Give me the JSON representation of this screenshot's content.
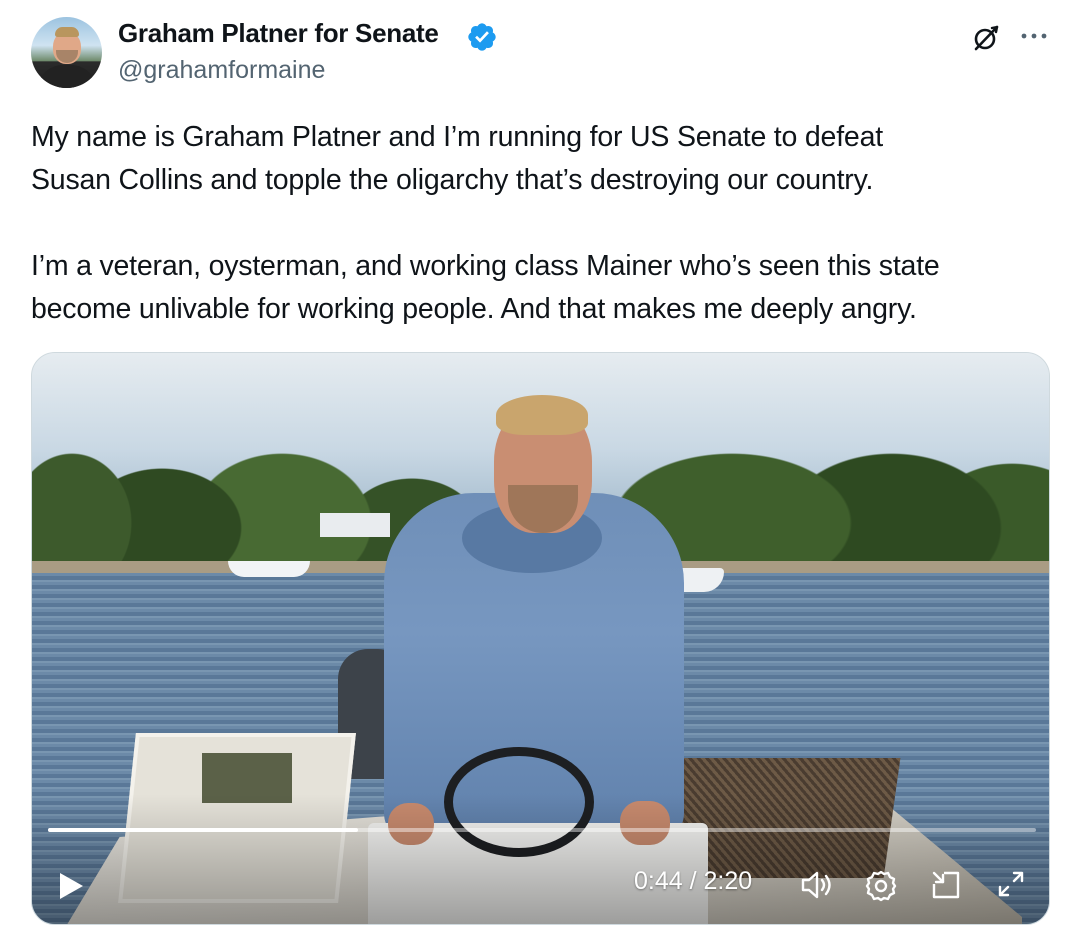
{
  "author": {
    "name": "Graham Platner for Senate",
    "handle": "@grahamformaine",
    "verified": true,
    "verified_color": "#1d9bf0"
  },
  "tweet": {
    "paragraphs": [
      [
        "My name is Graham Platner and I’m running for US Senate to defeat",
        "Susan Collins and topple the oligarchy that’s destroying our country."
      ],
      [
        "I’m a veteran, oysterman, and working class Mainer who’s seen this state",
        "become unlivable for working people. And that makes me deeply angry."
      ]
    ]
  },
  "video": {
    "current_time": "0:44",
    "duration": "2:20",
    "time_display": "0:44 / 2:20",
    "progress_fraction": 0.314,
    "controls": [
      "play-icon",
      "volume-icon",
      "settings-icon",
      "picture-in-picture-icon",
      "fullscreen-icon"
    ]
  },
  "icons": {
    "header_right": [
      "grok-icon",
      "more-icon"
    ]
  }
}
